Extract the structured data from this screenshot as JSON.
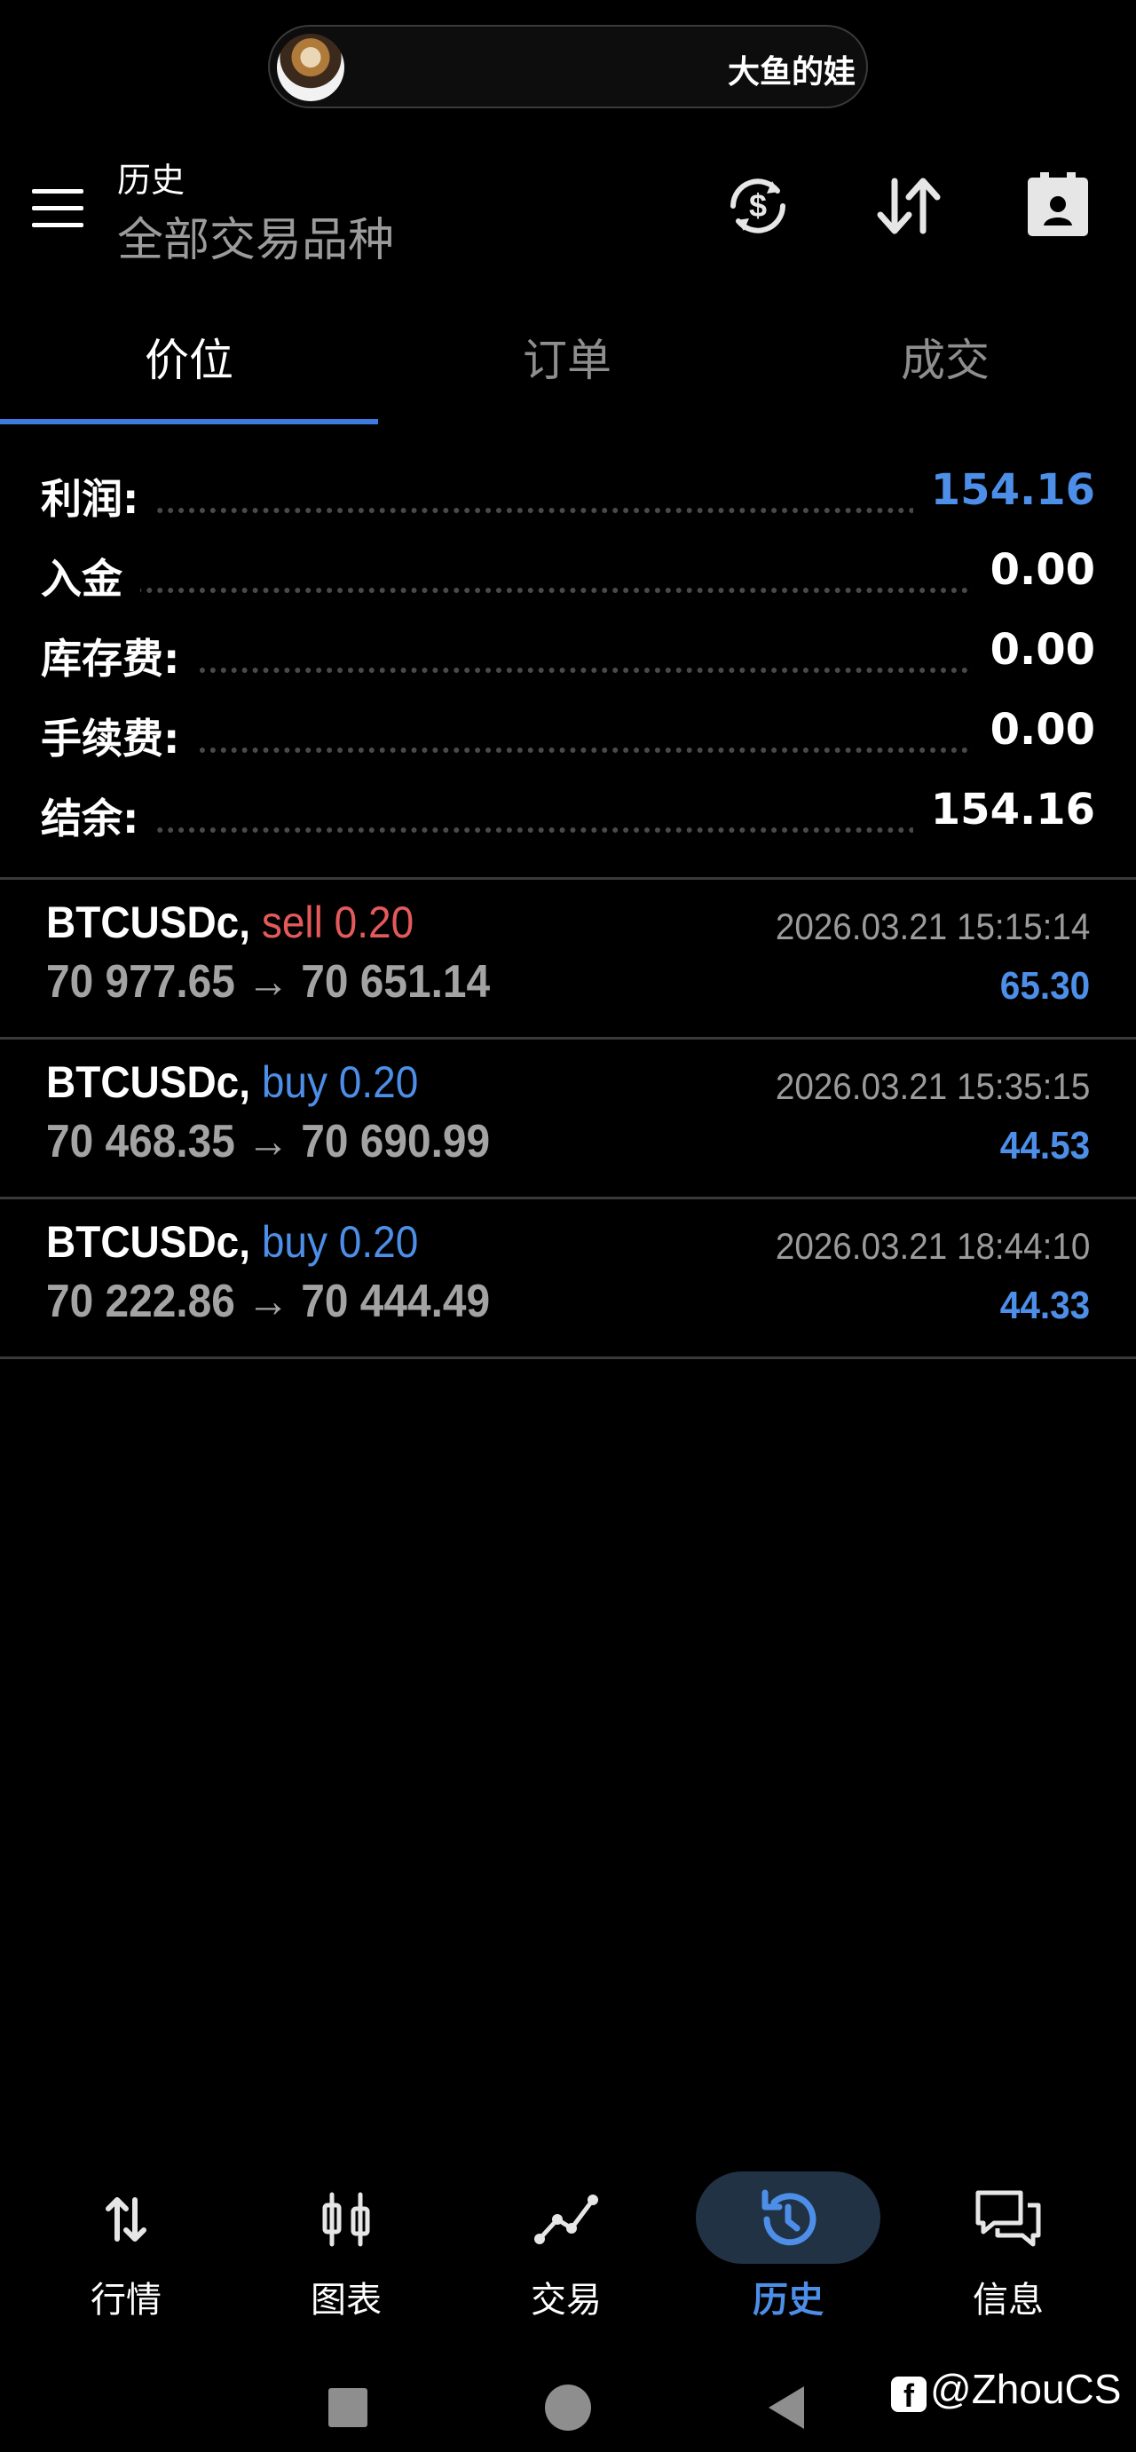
{
  "top_pill": {
    "text": "大鱼的娃"
  },
  "header": {
    "title": "历史",
    "subtitle": "全部交易品种"
  },
  "tabs": [
    {
      "label": "价位",
      "active": true
    },
    {
      "label": "订单",
      "active": false
    },
    {
      "label": "成交",
      "active": false
    }
  ],
  "summary": [
    {
      "label": "利润:",
      "value": "154.16",
      "highlight": true
    },
    {
      "label": "入金",
      "value": "0.00",
      "highlight": false
    },
    {
      "label": "库存费:",
      "value": "0.00",
      "highlight": false
    },
    {
      "label": "手续费:",
      "value": "0.00",
      "highlight": false
    },
    {
      "label": "结余:",
      "value": "154.16",
      "highlight": false
    }
  ],
  "deals": [
    {
      "symbol": "BTCUSDc,",
      "side": "sell 0.20",
      "side_type": "sell",
      "open": "70 977.65",
      "close": "70 651.14",
      "arrow": "→",
      "time": "2026.03.21 15:15:14",
      "profit": "65.30"
    },
    {
      "symbol": "BTCUSDc,",
      "side": "buy 0.20",
      "side_type": "buy",
      "open": "70 468.35",
      "close": "70 690.99",
      "arrow": "→",
      "time": "2026.03.21 15:35:15",
      "profit": "44.53"
    },
    {
      "symbol": "BTCUSDc,",
      "side": "buy 0.20",
      "side_type": "buy",
      "open": "70 222.86",
      "close": "70 444.49",
      "arrow": "→",
      "time": "2026.03.21 18:44:10",
      "profit": "44.33"
    }
  ],
  "bottom_nav": [
    {
      "label": "行情",
      "icon": "quotes-arrows-icon",
      "active": false
    },
    {
      "label": "图表",
      "icon": "candlestick-chart-icon",
      "active": false
    },
    {
      "label": "交易",
      "icon": "trade-line-icon",
      "active": false
    },
    {
      "label": "历史",
      "icon": "history-clock-icon",
      "active": true
    },
    {
      "label": "信息",
      "icon": "messages-icon",
      "active": false
    }
  ],
  "watermark": "@ZhouCS",
  "colors": {
    "accent": "#4d8fe8",
    "sell": "#e45a5a",
    "background": "#000000",
    "muted": "#9b9b9b"
  }
}
